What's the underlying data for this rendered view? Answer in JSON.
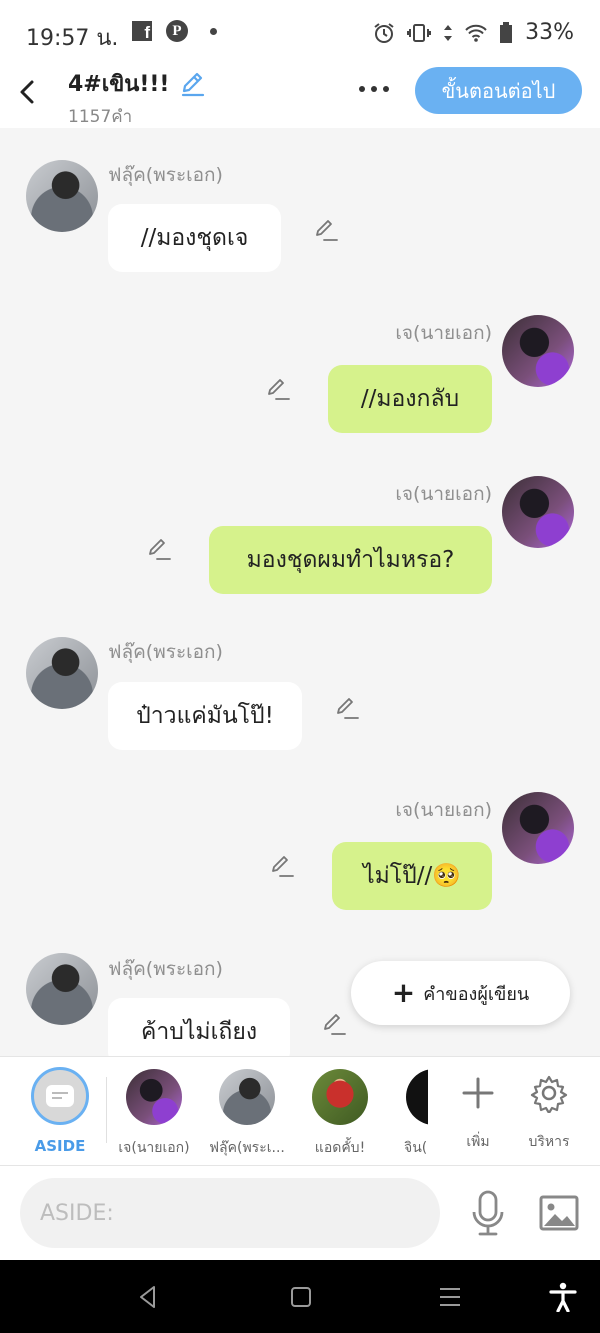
{
  "status_bar": {
    "time": "19:57 น.",
    "battery": "33%"
  },
  "header": {
    "title": "4#เขิน!!!",
    "word_count": "1157คำ",
    "next_button": "ขั้นตอนต่อไป"
  },
  "messages": [
    {
      "side": "left",
      "character": "ฟลุ๊ค(พระเอก)",
      "text": "//มองชุดเจ"
    },
    {
      "side": "right",
      "character": "เจ(นายเอก)",
      "text": "//มองกลับ"
    },
    {
      "side": "right",
      "character": "เจ(นายเอก)",
      "text": "มองชุดผมทำไมหรอ?"
    },
    {
      "side": "left",
      "character": "ฟลุ๊ค(พระเอก)",
      "text": "ป๋าวแค่มันโป๊!"
    },
    {
      "side": "right",
      "character": "เจ(นายเอก)",
      "text": "ไม่โป๊//🥺"
    },
    {
      "side": "left",
      "character": "ฟลุ๊ค(พระเอก)",
      "text": "ค้าบไม่เถียง"
    }
  ],
  "writer_button": "คำของผู้เขียน",
  "characters": {
    "aside": "ASIDE",
    "jay": "เจ(นายเอก)",
    "flook": "ฟลุ๊ค(พระเ...",
    "ted": "แอดคั้บ!",
    "jin": "จิน("
  },
  "tools": {
    "add": "เพิ่ม",
    "manage": "บริหาร"
  },
  "input": {
    "placeholder": "ASIDE:"
  },
  "colors": {
    "accent": "#6ab1f2",
    "bubble_right": "#d6f28c",
    "bubble_left": "#ffffff",
    "background": "#f5f5f5"
  }
}
